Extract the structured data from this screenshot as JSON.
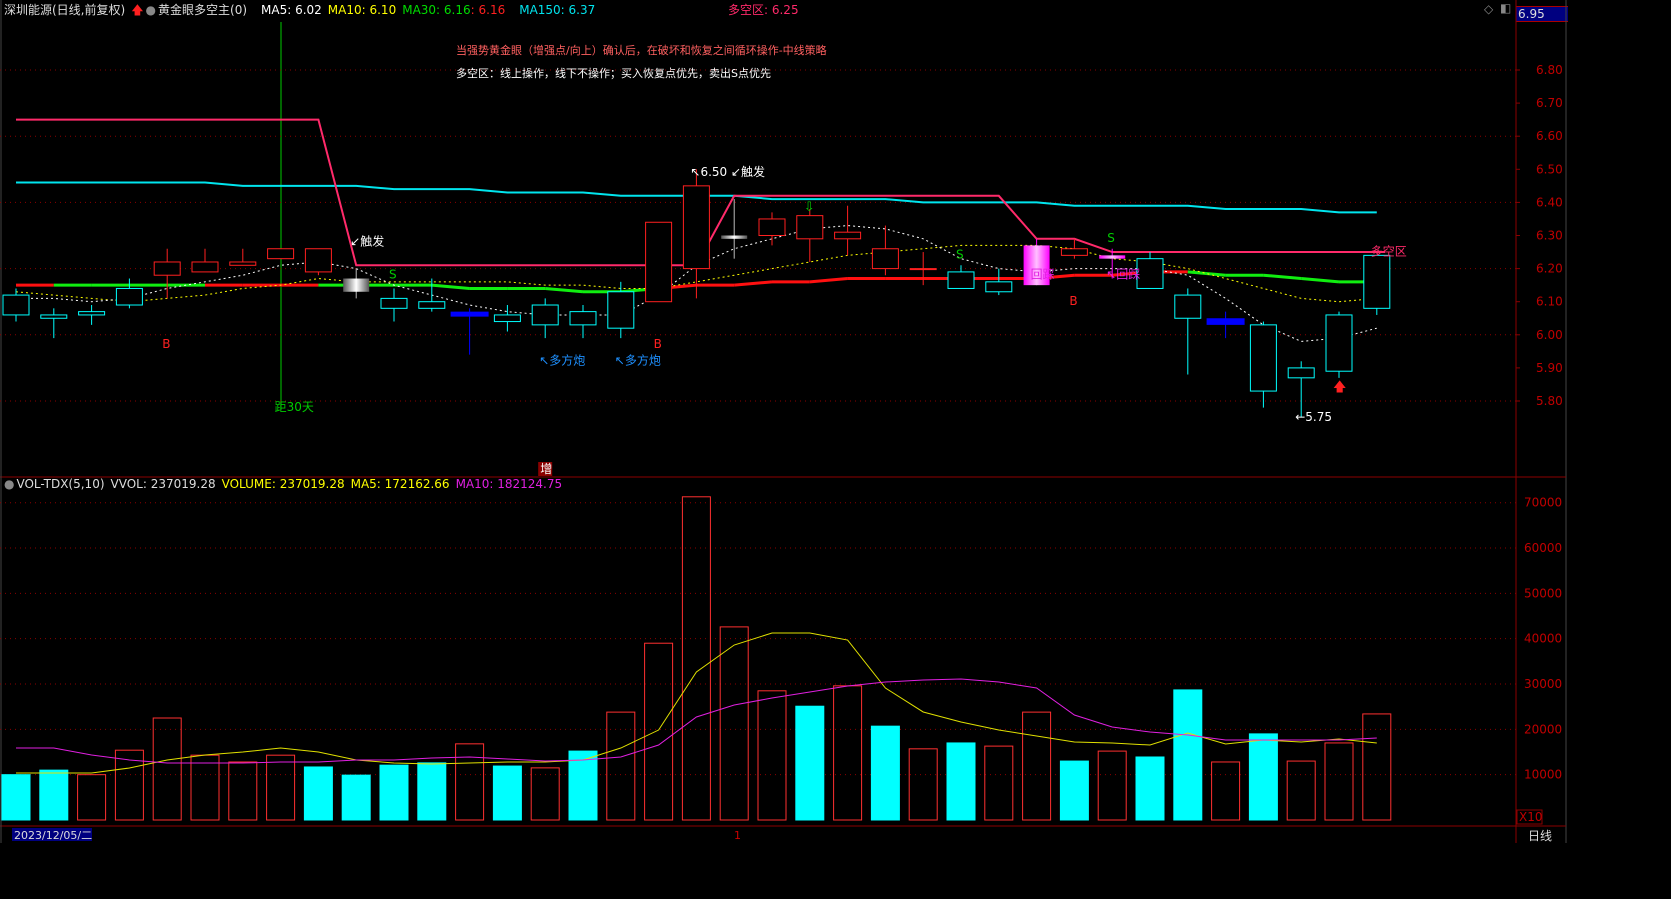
{
  "header": {
    "stock": "深圳能源(日线,前复权)",
    "indicator": "黄金眼多空主(0)",
    "ma5": "MA5: 6.02",
    "ma10": "MA10: 6.10",
    "ma30": "MA30: 6.16",
    "ma30_alt": ": 6.16",
    "ma150": "MA150: 6.37",
    "zone": "多空区: 6.25",
    "note1": "当强势黄金眼（增强点/向上）确认后，在破坏和恢复之间循环操作-中线策略",
    "note2": "多空区：线上操作，线下不操作；买入恢复点优先，卖出S点优先",
    "current_price": "6.95"
  },
  "volume_header": {
    "name": "VOL-TDX(5,10)",
    "vvol": "VVOL: 237019.28",
    "volume": "VOLUME: 237019.28",
    "ma5": "MA5: 172162.66",
    "ma10": "MA10: 182124.75"
  },
  "footer": {
    "date": "2023/12/05/二",
    "marker": "1",
    "period": "日线",
    "scale": "X10"
  },
  "colors": {
    "up": "#ff2020",
    "down": "#00ffff",
    "ma5": "#ffffff",
    "ma10": "#ffff00",
    "ma150": "#00e5ee",
    "zone": "#ff2a6a",
    "vol_ma5": "#e0e000",
    "vol_ma10": "#e020e0",
    "axis": "#c00000"
  },
  "chart_data": [
    {
      "type": "candlestick",
      "yticks": [
        "6.80",
        "6.70",
        "6.60",
        "6.50",
        "6.40",
        "6.30",
        "6.20",
        "6.10",
        "6.00",
        "5.90",
        "5.80"
      ],
      "ylim": [
        5.7,
        6.95
      ],
      "candles": [
        {
          "o": 6.12,
          "h": 6.14,
          "l": 6.04,
          "c": 6.06,
          "t": "down"
        },
        {
          "o": 6.06,
          "h": 6.08,
          "l": 5.99,
          "c": 6.05,
          "t": "down"
        },
        {
          "o": 6.07,
          "h": 6.09,
          "l": 6.03,
          "c": 6.06,
          "t": "down"
        },
        {
          "o": 6.14,
          "h": 6.17,
          "l": 6.08,
          "c": 6.09,
          "t": "down"
        },
        {
          "o": 6.18,
          "h": 6.26,
          "l": 6.11,
          "c": 6.22,
          "t": "up"
        },
        {
          "o": 6.19,
          "h": 6.26,
          "l": 6.19,
          "c": 6.22,
          "t": "up"
        },
        {
          "o": 6.21,
          "h": 6.26,
          "l": 6.21,
          "c": 6.22,
          "t": "up"
        },
        {
          "o": 6.23,
          "h": 6.26,
          "l": 6.23,
          "c": 6.26,
          "t": "up"
        },
        {
          "o": 6.19,
          "h": 6.26,
          "l": 6.18,
          "c": 6.26,
          "t": "up"
        },
        {
          "o": 6.17,
          "h": 6.2,
          "l": 6.11,
          "c": 6.13,
          "t": "gray"
        },
        {
          "o": 6.11,
          "h": 6.14,
          "l": 6.04,
          "c": 6.08,
          "t": "down"
        },
        {
          "o": 6.1,
          "h": 6.17,
          "l": 6.07,
          "c": 6.08,
          "t": "down"
        },
        {
          "o": 6.07,
          "h": 6.08,
          "l": 5.94,
          "c": 6.06,
          "t": "blue"
        },
        {
          "o": 6.06,
          "h": 6.09,
          "l": 6.01,
          "c": 6.04,
          "t": "down"
        },
        {
          "o": 6.09,
          "h": 6.11,
          "l": 5.99,
          "c": 6.03,
          "t": "down"
        },
        {
          "o": 6.07,
          "h": 6.09,
          "l": 5.99,
          "c": 6.03,
          "t": "down"
        },
        {
          "o": 6.13,
          "h": 6.16,
          "l": 5.99,
          "c": 6.02,
          "t": "down"
        },
        {
          "o": 6.1,
          "h": 6.34,
          "l": 6.1,
          "c": 6.34,
          "t": "up"
        },
        {
          "o": 6.2,
          "h": 6.5,
          "l": 6.11,
          "c": 6.45,
          "t": "up"
        },
        {
          "o": 6.3,
          "h": 6.41,
          "l": 6.23,
          "c": 6.29,
          "t": "gray"
        },
        {
          "o": 6.3,
          "h": 6.37,
          "l": 6.27,
          "c": 6.35,
          "t": "up"
        },
        {
          "o": 6.29,
          "h": 6.38,
          "l": 6.22,
          "c": 6.36,
          "t": "up"
        },
        {
          "o": 6.29,
          "h": 6.39,
          "l": 6.24,
          "c": 6.31,
          "t": "up"
        },
        {
          "o": 6.2,
          "h": 6.33,
          "l": 6.18,
          "c": 6.26,
          "t": "up"
        },
        {
          "o": 6.2,
          "h": 6.25,
          "l": 6.15,
          "c": 6.2,
          "t": "up"
        },
        {
          "o": 6.19,
          "h": 6.21,
          "l": 6.14,
          "c": 6.14,
          "t": "down"
        },
        {
          "o": 6.16,
          "h": 6.2,
          "l": 6.12,
          "c": 6.13,
          "t": "down"
        },
        {
          "o": 6.27,
          "h": 6.29,
          "l": 6.15,
          "c": 6.15,
          "t": "magenta"
        },
        {
          "o": 6.24,
          "h": 6.29,
          "l": 6.23,
          "c": 6.26,
          "t": "up"
        },
        {
          "o": 6.24,
          "h": 6.26,
          "l": 6.17,
          "c": 6.23,
          "t": "magenta"
        },
        {
          "o": 6.23,
          "h": 6.25,
          "l": 6.14,
          "c": 6.14,
          "t": "down"
        },
        {
          "o": 6.12,
          "h": 6.14,
          "l": 5.88,
          "c": 6.05,
          "t": "down"
        },
        {
          "o": 6.05,
          "h": 6.07,
          "l": 5.99,
          "c": 6.03,
          "t": "blue"
        },
        {
          "o": 6.03,
          "h": 6.04,
          "l": 5.78,
          "c": 5.83,
          "t": "down"
        },
        {
          "o": 5.9,
          "h": 5.92,
          "l": 5.75,
          "c": 5.87,
          "t": "down"
        },
        {
          "o": 6.06,
          "h": 6.07,
          "l": 5.87,
          "c": 5.89,
          "t": "down"
        },
        {
          "o": 6.24,
          "h": 6.24,
          "l": 6.06,
          "c": 6.08,
          "t": "down"
        }
      ],
      "ma5": [
        6.11,
        6.11,
        6.1,
        6.11,
        6.14,
        6.16,
        6.18,
        6.21,
        6.22,
        6.2,
        6.15,
        6.12,
        6.09,
        6.07,
        6.06,
        6.06,
        6.06,
        6.12,
        6.21,
        6.26,
        6.29,
        6.32,
        6.33,
        6.32,
        6.29,
        6.23,
        6.2,
        6.19,
        6.2,
        6.2,
        6.2,
        6.18,
        6.11,
        6.03,
        5.98,
        5.99,
        6.02
      ],
      "ma10": [
        6.13,
        6.12,
        6.11,
        6.1,
        6.11,
        6.12,
        6.14,
        6.15,
        6.17,
        6.16,
        6.16,
        6.16,
        6.16,
        6.16,
        6.15,
        6.15,
        6.14,
        6.14,
        6.16,
        6.18,
        6.2,
        6.22,
        6.24,
        6.25,
        6.26,
        6.27,
        6.27,
        6.27,
        6.26,
        6.23,
        6.22,
        6.2,
        6.17,
        6.14,
        6.11,
        6.1,
        6.11
      ],
      "ma30": [
        6.15,
        6.15,
        6.15,
        6.15,
        6.15,
        6.15,
        6.15,
        6.15,
        6.15,
        6.15,
        6.15,
        6.15,
        6.14,
        6.14,
        6.14,
        6.13,
        6.13,
        6.14,
        6.15,
        6.15,
        6.16,
        6.16,
        6.17,
        6.17,
        6.17,
        6.17,
        6.17,
        6.17,
        6.18,
        6.18,
        6.19,
        6.19,
        6.18,
        6.18,
        6.17,
        6.16,
        6.16
      ],
      "ma30_trend": [
        "up",
        "down",
        "down",
        "down",
        "down",
        "up",
        "up",
        "up",
        "down",
        "down",
        "down",
        "down",
        "down",
        "down",
        "down",
        "down",
        "down",
        "up",
        "up",
        "up",
        "up",
        "up",
        "up",
        "up",
        "up",
        "up",
        "up",
        "up",
        "up",
        "up",
        "up",
        "down",
        "down",
        "down",
        "down",
        "down",
        "down"
      ],
      "ma150": [
        6.46,
        6.46,
        6.46,
        6.46,
        6.46,
        6.46,
        6.45,
        6.45,
        6.45,
        6.45,
        6.44,
        6.44,
        6.44,
        6.43,
        6.43,
        6.43,
        6.42,
        6.42,
        6.42,
        6.42,
        6.41,
        6.41,
        6.41,
        6.41,
        6.4,
        6.4,
        6.4,
        6.4,
        6.39,
        6.39,
        6.39,
        6.39,
        6.38,
        6.38,
        6.38,
        6.37,
        6.37
      ],
      "zone": [
        6.65,
        6.65,
        6.65,
        6.65,
        6.65,
        6.65,
        6.65,
        6.65,
        6.65,
        6.21,
        6.21,
        6.21,
        6.21,
        6.21,
        6.21,
        6.21,
        6.21,
        6.21,
        6.21,
        6.42,
        6.42,
        6.42,
        6.42,
        6.42,
        6.42,
        6.42,
        6.42,
        6.29,
        6.29,
        6.25,
        6.25,
        6.25,
        6.25,
        6.25,
        6.25,
        6.25,
        6.25
      ],
      "annotations": [
        {
          "i": 4,
          "p": 5.96,
          "text": "B",
          "color": "#ff2020"
        },
        {
          "i": 17,
          "p": 5.96,
          "text": "B",
          "color": "#ff2020"
        },
        {
          "i": 28,
          "p": 6.09,
          "text": "B",
          "color": "#ff2020"
        },
        {
          "i": 10,
          "p": 6.17,
          "text": "S",
          "color": "#00cc00"
        },
        {
          "i": 25,
          "p": 6.23,
          "text": "S",
          "color": "#00cc00"
        },
        {
          "i": 29,
          "p": 6.28,
          "text": "S",
          "color": "#00cc00"
        },
        {
          "i": 9,
          "p": 6.27,
          "text": "↙触发",
          "color": "#ffffff"
        },
        {
          "i": 18,
          "p": 6.48,
          "text": "↖6.50 ↙触发",
          "color": "#ffffff"
        },
        {
          "i": 14,
          "p": 5.91,
          "text": "↖多方炮",
          "color": "#1e90ff"
        },
        {
          "i": 16,
          "p": 5.91,
          "text": "↖多方炮",
          "color": "#1e90ff"
        },
        {
          "i": 7,
          "p": 5.77,
          "text": "距30天",
          "color": "#00cc00"
        },
        {
          "i": 34,
          "p": 5.74,
          "text": "←5.75",
          "color": "#ffffff"
        },
        {
          "i": 36,
          "p": 6.24,
          "text": "多空区",
          "color": "#ff2a6a"
        },
        {
          "i": 27,
          "p": 6.17,
          "text": "回踩",
          "color": "#e020e0"
        },
        {
          "i": 29,
          "p": 6.17,
          "text": "↖回踩",
          "color": "#e020e0"
        },
        {
          "i": 14,
          "p": 5.6,
          "text": "增",
          "color": "#ffffff"
        }
      ]
    },
    {
      "type": "bar",
      "yticks": [
        "70000",
        "60000",
        "50000",
        "40000",
        "30000",
        "20000",
        "10000"
      ],
      "ylim": [
        0,
        72000
      ],
      "volumes": [
        10000,
        11000,
        10000,
        15400,
        22500,
        14300,
        12800,
        14300,
        11700,
        9900,
        12100,
        12600,
        16800,
        11900,
        11500,
        15200,
        23800,
        39000,
        71300,
        42600,
        28500,
        25100,
        29600,
        20700,
        15700,
        17000,
        16300,
        23800,
        13000,
        15200,
        13900,
        28700,
        12800,
        19000,
        13000,
        17000,
        23400
      ],
      "bar_style": [
        "solid",
        "solid",
        "hollow",
        "hollow",
        "hollow",
        "hollow",
        "hollow",
        "hollow",
        "solid",
        "solid",
        "solid",
        "solid",
        "hollow",
        "solid",
        "hollow",
        "solid",
        "hollow",
        "hollow",
        "hollow",
        "hollow",
        "hollow",
        "solid",
        "hollow",
        "solid",
        "hollow",
        "solid",
        "hollow",
        "hollow",
        "solid",
        "hollow",
        "solid",
        "solid",
        "hollow",
        "solid",
        "hollow",
        "hollow",
        "hollow"
      ],
      "ma5": [
        10370,
        10370,
        10370,
        11470,
        13240,
        14340,
        15000,
        15880,
        15000,
        13240,
        12570,
        12350,
        12570,
        12790,
        12790,
        13240,
        15880,
        19850,
        32650,
        38600,
        41250,
        41250,
        39700,
        29120,
        23830,
        21620,
        19850,
        18530,
        17200,
        16990,
        16540,
        19190,
        16770,
        17650,
        17200,
        17870,
        16990
      ],
      "ma10": [
        15880,
        15880,
        14340,
        13240,
        12570,
        12570,
        12570,
        12790,
        12790,
        13240,
        13240,
        13680,
        13900,
        13460,
        13020,
        13240,
        13900,
        16540,
        22720,
        25370,
        26910,
        28240,
        29560,
        30440,
        30880,
        31100,
        30440,
        29120,
        23160,
        20520,
        19410,
        18750,
        17650,
        17650,
        17650,
        17650,
        18090
      ]
    }
  ]
}
